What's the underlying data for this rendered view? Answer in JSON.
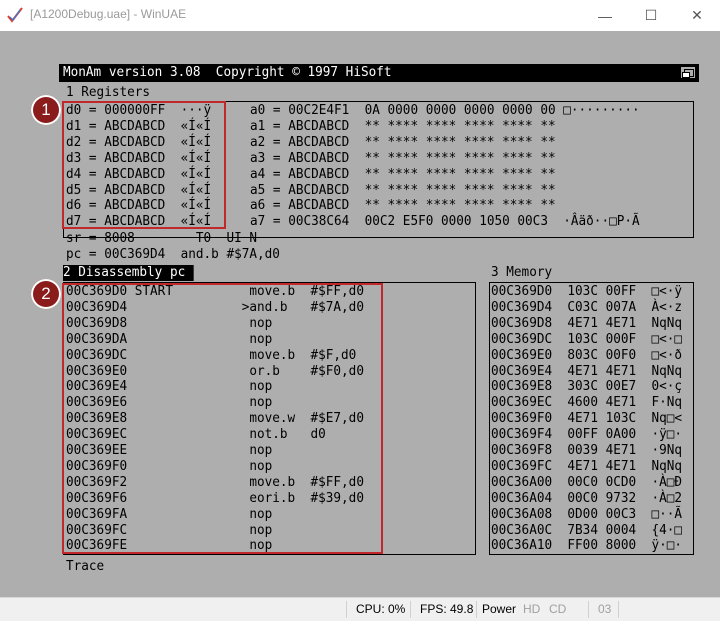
{
  "window": {
    "title": "[A1200Debug.uae] - WinUAE",
    "minimize": "—",
    "maximize": "☐",
    "close": "✕"
  },
  "monam": {
    "header": "MonAm version 3.08  Copyright © 1997 HiSoft",
    "registers_label": "1 Registers",
    "data_regs": [
      "d0 = 000000FF  ···ÿ",
      "d1 = ABCDABCD  «Í«Í",
      "d2 = ABCDABCD  «Í«Í",
      "d3 = ABCDABCD  «Í«Í",
      "d4 = ABCDABCD  «Í«Í",
      "d5 = ABCDABCD  «Í«Í",
      "d6 = ABCDABCD  «Í«Í",
      "d7 = ABCDABCD  «Í«Í"
    ],
    "addr_regs": [
      "a0 = 00C2E4F1  0A 0000 0000 0000 0000 00 □·········",
      "a1 = ABCDABCD  ** **** **** **** **** **",
      "a2 = ABCDABCD  ** **** **** **** **** **",
      "a3 = ABCDABCD  ** **** **** **** **** **",
      "a4 = ABCDABCD  ** **** **** **** **** **",
      "a5 = ABCDABCD  ** **** **** **** **** **",
      "a6 = ABCDABCD  ** **** **** **** **** **",
      "a7 = 00C38C64  00C2 E5F0 0000 1050 00C3  ·Âäð··□P·Ã"
    ],
    "sr_line": "sr = 8008        T0  UI N",
    "pc_line": "pc = 00C369D4  and.b #$7A,d0",
    "disasm_label": "2 Disassembly pc",
    "disasm_lines": [
      "00C369D0 START          move.b  #$FF,d0",
      "00C369D4               >and.b   #$7A,d0",
      "00C369D8                nop",
      "00C369DA                nop",
      "00C369DC                move.b  #$F,d0",
      "00C369E0                or.b    #$F0,d0",
      "00C369E4                nop",
      "00C369E6                nop",
      "00C369E8                move.w  #$E7,d0",
      "00C369EC                not.b   d0",
      "00C369EE                nop",
      "00C369F0                nop",
      "00C369F2                move.b  #$FF,d0",
      "00C369F6                eori.b  #$39,d0",
      "00C369FA                nop",
      "00C369FC                nop",
      "00C369FE                nop"
    ],
    "memory_label": "3 Memory",
    "memory_lines": [
      "00C369D0  103C 00FF  □<·ÿ",
      "00C369D4  C03C 007A  À<·z",
      "00C369D8  4E71 4E71  NqNq",
      "00C369DC  103C 000F  □<·□",
      "00C369E0  803C 00F0  □<·ð",
      "00C369E4  4E71 4E71  NqNq",
      "00C369E8  303C 00E7  0<·ç",
      "00C369EC  4600 4E71  F·Nq",
      "00C369F0  4E71 103C  Nq□<",
      "00C369F4  00FF 0A00  ·ÿ□·",
      "00C369F8  0039 4E71  ·9Nq",
      "00C369FC  4E71 4E71  NqNq",
      "00C36A00  00C0 0CD0  ·À□Ð",
      "00C36A04  00C0 9732  ·À□2",
      "00C36A08  0D00 00C3  □··Ã",
      "00C36A0C  7B34 0004  {4·□",
      "00C36A10  FF00 8000  ÿ·□·"
    ],
    "footer": "Trace"
  },
  "annotations": {
    "marker_1": "1",
    "marker_2": "2"
  },
  "status": {
    "cpu": "CPU: 0%",
    "fps": "FPS: 49.8",
    "power": "Power",
    "hd": "HD",
    "cd": "CD",
    "drive": "03"
  },
  "colors": {
    "screen_bg": "#aeaeae",
    "highlight": "#c0282c",
    "marker": "#8b1c1c"
  }
}
